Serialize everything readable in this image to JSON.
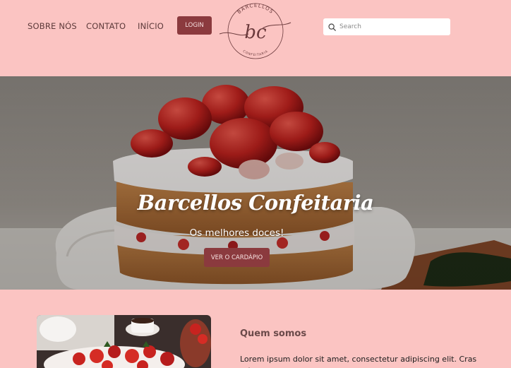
{
  "header": {
    "nav": [
      {
        "label": "SOBRE NÓS"
      },
      {
        "label": "CONTATO"
      },
      {
        "label": "INÍCIO"
      }
    ],
    "login_label": "LOGIN",
    "logo": {
      "top_text": "BARCELLOS",
      "monogram": "bc",
      "bottom_text": "CONFEITARIA"
    },
    "search": {
      "placeholder": "Search",
      "icon": "search-icon"
    }
  },
  "hero": {
    "title": "Barcellos Confeitaria",
    "subtitle": "Os melhores doces!",
    "cta_label": "VER O CARDÁPIO"
  },
  "about": {
    "heading": "Quem somos",
    "text": "Lorem ipsum dolor sit amet, consectetur adipiscing elit. Cras rutrum"
  },
  "colors": {
    "background": "#fbc4c2",
    "accent": "#8b3a3e"
  }
}
